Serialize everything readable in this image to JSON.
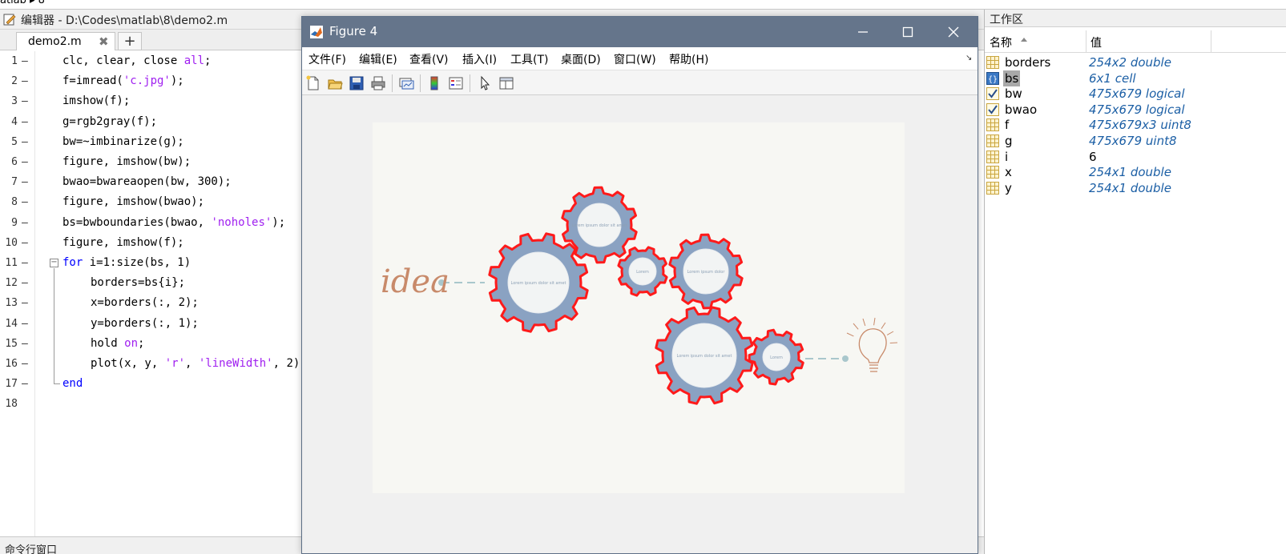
{
  "top_strip": {
    "path_text": "atlab ▸ 8"
  },
  "editor": {
    "title": "编辑器 - D:\\Codes\\matlab\\8\\demo2.m",
    "tab_label": "demo2.m",
    "tab_close": "✖",
    "tab_add": "+",
    "lines": [
      {
        "n": "1",
        "tokens": [
          {
            "t": "clc, clear, close "
          },
          {
            "t": "all",
            "c": "str"
          },
          {
            "t": ";"
          }
        ]
      },
      {
        "n": "2",
        "tokens": [
          {
            "t": "f=imread("
          },
          {
            "t": "'c.jpg'",
            "c": "str"
          },
          {
            "t": ");"
          }
        ]
      },
      {
        "n": "3",
        "tokens": [
          {
            "t": "imshow(f);"
          }
        ]
      },
      {
        "n": "4",
        "tokens": [
          {
            "t": "g=rgb2gray(f);"
          }
        ]
      },
      {
        "n": "5",
        "tokens": [
          {
            "t": "bw=~imbinarize(g);"
          }
        ]
      },
      {
        "n": "6",
        "tokens": [
          {
            "t": "figure, imshow(bw);"
          }
        ]
      },
      {
        "n": "7",
        "tokens": [
          {
            "t": "bwao=bwareaopen(bw, 300);"
          }
        ]
      },
      {
        "n": "8",
        "tokens": [
          {
            "t": "figure, imshow(bwao);"
          }
        ]
      },
      {
        "n": "9",
        "tokens": [
          {
            "t": "bs=bwboundaries(bwao, "
          },
          {
            "t": "'noholes'",
            "c": "str"
          },
          {
            "t": ");"
          }
        ]
      },
      {
        "n": "10",
        "tokens": [
          {
            "t": "figure, imshow(f);"
          }
        ]
      },
      {
        "n": "11",
        "tokens": [
          {
            "t": "for",
            "c": "kw"
          },
          {
            "t": " i=1:size(bs, 1)"
          }
        ]
      },
      {
        "n": "12",
        "indent": 1,
        "tokens": [
          {
            "t": "borders=bs{i};"
          }
        ]
      },
      {
        "n": "13",
        "indent": 1,
        "tokens": [
          {
            "t": "x=borders(:, 2);"
          }
        ]
      },
      {
        "n": "14",
        "indent": 1,
        "tokens": [
          {
            "t": "y=borders(:, 1);"
          }
        ]
      },
      {
        "n": "15",
        "indent": 1,
        "tokens": [
          {
            "t": "hold "
          },
          {
            "t": "on",
            "c": "str"
          },
          {
            "t": ";"
          }
        ]
      },
      {
        "n": "16",
        "indent": 1,
        "tokens": [
          {
            "t": "plot(x, y, "
          },
          {
            "t": "'r'",
            "c": "str"
          },
          {
            "t": ", "
          },
          {
            "t": "'lineWidth'",
            "c": "str"
          },
          {
            "t": ", 2);"
          }
        ]
      },
      {
        "n": "17",
        "tokens": [
          {
            "t": "end",
            "c": "kw"
          }
        ]
      },
      {
        "n": "18",
        "tokens": []
      }
    ],
    "dash": "—"
  },
  "command_strip": {
    "label": "命令行窗口"
  },
  "workspace": {
    "title": "工作区",
    "col_name": "名称",
    "col_value": "值",
    "vars": [
      {
        "name": "borders",
        "value": "254x2 double",
        "icon": "matrix-icon"
      },
      {
        "name": "bs",
        "value": "6x1 cell",
        "icon": "cell-icon",
        "selected": true
      },
      {
        "name": "bw",
        "value": "475x679 logical",
        "icon": "logical-icon"
      },
      {
        "name": "bwao",
        "value": "475x679 logical",
        "icon": "logical-icon"
      },
      {
        "name": "f",
        "value": "475x679x3 uint8",
        "icon": "matrix-icon"
      },
      {
        "name": "g",
        "value": "475x679 uint8",
        "icon": "matrix-icon"
      },
      {
        "name": "i",
        "value": "6",
        "icon": "matrix-icon",
        "plain": true
      },
      {
        "name": "x",
        "value": "254x1 double",
        "icon": "matrix-icon"
      },
      {
        "name": "y",
        "value": "254x1 double",
        "icon": "matrix-icon"
      }
    ]
  },
  "figure": {
    "title": "Figure 4",
    "menus": [
      "文件(F)",
      "编辑(E)",
      "查看(V)",
      "插入(I)",
      "工具(T)",
      "桌面(D)",
      "窗口(W)",
      "帮助(H)"
    ],
    "dock_glyph": "↘",
    "toolbar_icons": [
      "new-figure-icon",
      "open-file-icon",
      "save-icon",
      "print-icon",
      "link-plot-icon",
      "colorbar-icon",
      "legend-icon",
      "pointer-icon",
      "property-editor-icon"
    ],
    "image": {
      "idea_text": "idea",
      "gear_texts": [
        "Lorem ipsum dolor sit amet",
        "Lorem ipsum dolor sit amet",
        "Lorem",
        "Lorem ipsum dolor",
        "Lorem ipsum dolor sit amet",
        "Lorem"
      ],
      "outline_color": "#ff1a1a",
      "gear_color": "#8aa2c2",
      "accent_color": "#a9c7cc",
      "sketch_color": "#c88a6a"
    }
  }
}
